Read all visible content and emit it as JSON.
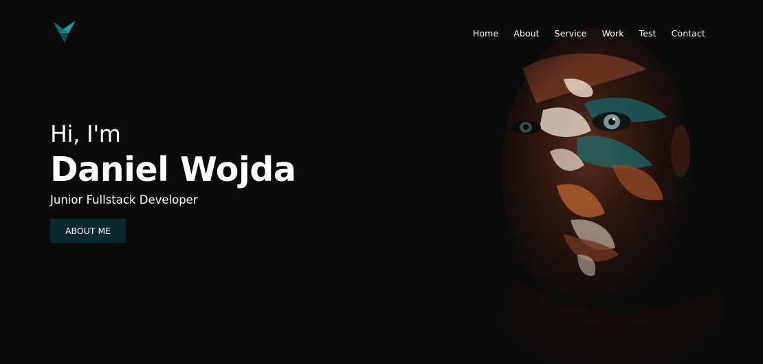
{
  "brand": {
    "logo_icon": "origami-bird-icon",
    "accent": "#1e9aa0"
  },
  "nav": {
    "items": [
      {
        "label": "Home"
      },
      {
        "label": "About"
      },
      {
        "label": "Service"
      },
      {
        "label": "Work"
      },
      {
        "label": "Test"
      },
      {
        "label": "Contact"
      }
    ]
  },
  "hero": {
    "greeting": "Hi, I'm",
    "name": "Daniel Wojda",
    "subtitle": "Junior Fullstack Developer",
    "cta_label": "ABOUT ME",
    "cta_color": "#0b2a2f"
  },
  "portrait": {
    "description_icon": "painted-face-portrait"
  },
  "colors": {
    "background": "#0b0a0b",
    "text": "#ffffff"
  }
}
